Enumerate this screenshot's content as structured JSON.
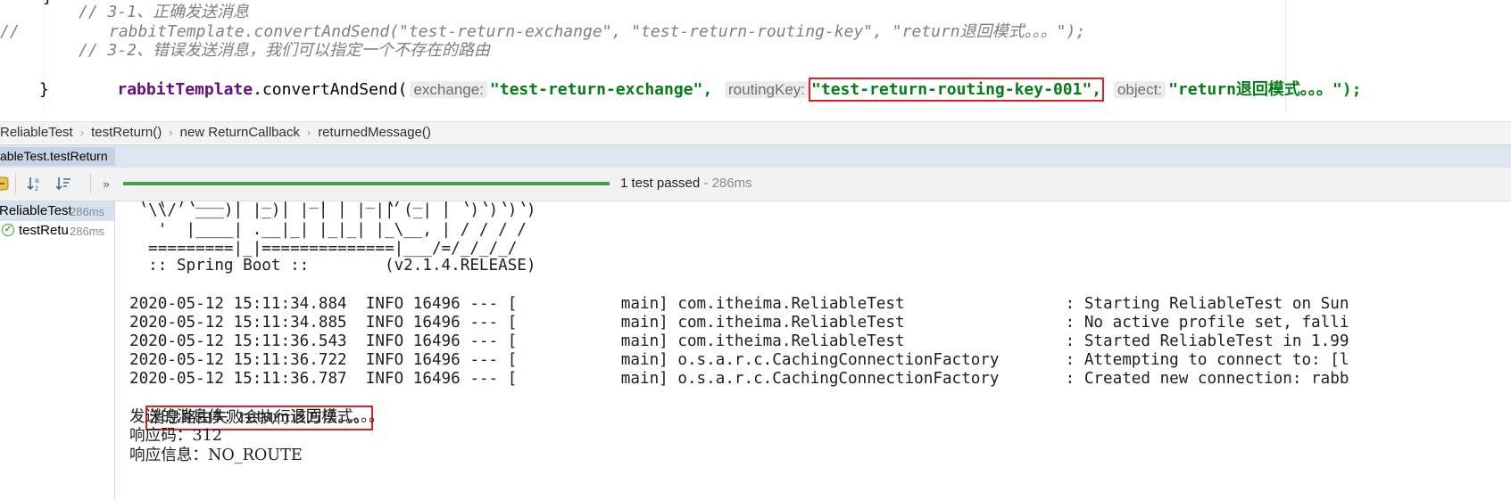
{
  "editor": {
    "line0": "// 3-1、正确发送消息",
    "line1_prefix": "//",
    "line1_code": "rabbitTemplate.convertAndSend(\"test-return-exchange\", \"test-return-routing-key\", \"return退回模式。。。\");",
    "line2": "// 3-2、错误发送消息，我们可以指定一个不存在的路由",
    "line3": {
      "field": "rabbitTemplate",
      "method": ".convertAndSend(",
      "hint_exchange": "exchange:",
      "arg_exchange": "\"test-return-exchange\",",
      "hint_routing": "routingKey:",
      "arg_routing": "\"test-return-routing-key-001\",",
      "hint_object": "object:",
      "arg_object": "\"return退回模式。。。\");"
    },
    "line4": "}"
  },
  "breadcrumb": [
    "ReliableTest",
    "testReturn()",
    "new ReturnCallback",
    "returnedMessage()"
  ],
  "run_tab": "ableTest.testReturn",
  "toolbar": {
    "sort_alpha_icon": "sort-alphabetically-icon",
    "sort_duration_icon": "sort-by-duration-icon",
    "more": "»",
    "progress": 1.0,
    "status": "1 test passed",
    "duration": " - 286ms"
  },
  "tree": [
    {
      "label": "ReliableTest",
      "time": "286ms"
    },
    {
      "label": "testReturn",
      "time": "286ms"
    }
  ],
  "console": {
    "banner": [
      " ( ( )\\___ | '_ | '_| | '_ \\/ _` | \\ \\ \\ \\",
      "  \\\\/  ___)| |_)| | | | | || (_| |  ) ) ) )",
      "   '  |____| .__|_| |_|_| |_\\__, | / / / /",
      "  =========|_|==============|___/=/_/_/_/",
      "  :: Spring Boot ::        (v2.1.4.RELEASE)"
    ],
    "logs": [
      "2020-05-12 15:11:34.884  INFO 16496 --- [           main] com.itheima.ReliableTest                 : Starting ReliableTest on Sun",
      "2020-05-12 15:11:34.885  INFO 16496 --- [           main] com.itheima.ReliableTest                 : No active profile set, falli",
      "2020-05-12 15:11:36.543  INFO 16496 --- [           main] com.itheima.ReliableTest                 : Started ReliableTest in 1.99",
      "2020-05-12 15:11:36.722  INFO 16496 --- [           main] o.s.a.r.c.CachingConnectionFactory       : Attempting to connect to: [l",
      "2020-05-12 15:11:36.787  INFO 16496 --- [           main] o.s.a.r.c.CachingConnectionFactory       : Created new connection: rabb"
    ],
    "callback_msg": "消息路由失败会执行该方法。。。",
    "sent_body": "发送的消息体：return退回模式。。。",
    "reply_code": "响应码：312",
    "reply_text": "响应信息：NO_ROUTE"
  },
  "colors": {
    "string": "#067d17",
    "field": "#660e7a",
    "comment": "#808080",
    "highlight_box": "#e02020",
    "pass_green": "#43a047"
  }
}
